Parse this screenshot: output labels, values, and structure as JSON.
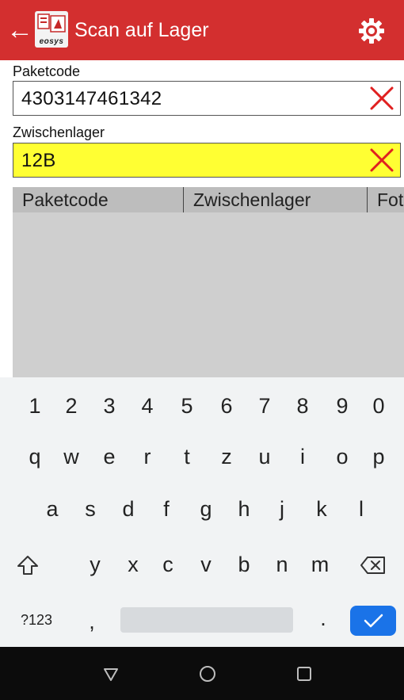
{
  "app": {
    "title": "Scan auf Lager",
    "logo_text": "eosys",
    "back_icon": "arrow-left-icon",
    "settings_icon": "gear-icon",
    "brand_color": "#d32f2f"
  },
  "form": {
    "paketcode": {
      "label": "Paketcode",
      "value": "4303147461342"
    },
    "zwischenlager": {
      "label": "Zwischenlager",
      "value": "12B",
      "highlight_color": "#ffff33"
    },
    "clear_icon": "close-icon"
  },
  "table": {
    "columns": [
      "Paketcode",
      "Zwischenlager",
      "Fot"
    ],
    "rows": []
  },
  "keyboard": {
    "numbers": [
      "1",
      "2",
      "3",
      "4",
      "5",
      "6",
      "7",
      "8",
      "9",
      "0"
    ],
    "row1": [
      "q",
      "w",
      "e",
      "r",
      "t",
      "z",
      "u",
      "i",
      "o",
      "p"
    ],
    "row2": [
      "a",
      "s",
      "d",
      "f",
      "g",
      "h",
      "j",
      "k",
      "l"
    ],
    "row3": [
      "y",
      "x",
      "c",
      "v",
      "b",
      "n",
      "m"
    ],
    "symbols_label": "?123",
    "comma": ",",
    "period": ".",
    "shift_icon": "shift-icon",
    "backspace_icon": "backspace-icon",
    "enter_icon": "check-icon",
    "accent_color": "#1a73e8"
  },
  "navbar": {
    "back_icon": "nav-back-icon",
    "home_icon": "nav-home-icon",
    "recents_icon": "nav-recents-icon"
  }
}
